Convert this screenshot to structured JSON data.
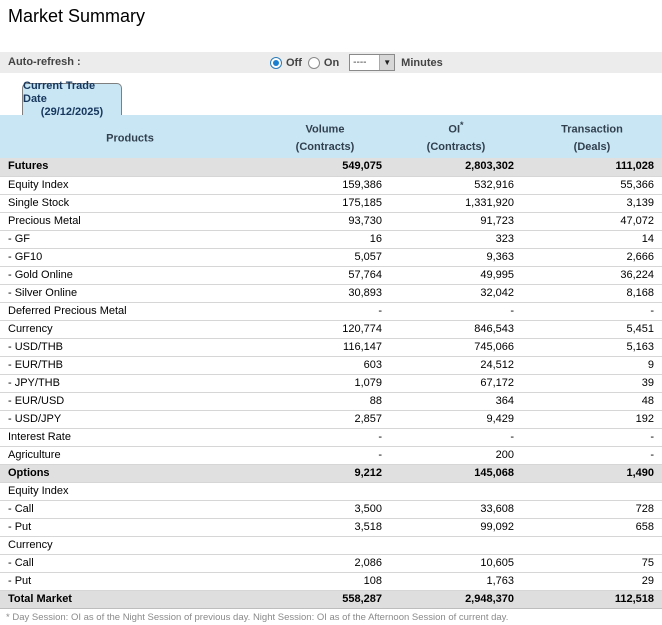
{
  "page": {
    "title": "Market Summary"
  },
  "auto_refresh": {
    "label": "Auto-refresh :",
    "off_label": "Off",
    "on_label": "On",
    "selected": "off",
    "interval_value": "----",
    "minutes_label": "Minutes"
  },
  "tab": {
    "line1": "Current Trade Date",
    "line2": "(29/12/2025)"
  },
  "table": {
    "columns": [
      {
        "label": "Products",
        "sup": "",
        "sub": ""
      },
      {
        "label": "Volume",
        "sup": "",
        "sub": "(Contracts)"
      },
      {
        "label": "OI",
        "sup": "*",
        "sub": "(Contracts)"
      },
      {
        "label": "Transaction",
        "sup": "",
        "sub": "(Deals)"
      }
    ],
    "rows": [
      {
        "product": "Futures",
        "volume": "549,075",
        "oi": "2,803,302",
        "transaction": "111,028",
        "style": "section"
      },
      {
        "product": "Equity Index",
        "volume": "159,386",
        "oi": "532,916",
        "transaction": "55,366",
        "style": "normal"
      },
      {
        "product": "Single Stock",
        "volume": "175,185",
        "oi": "1,331,920",
        "transaction": "3,139",
        "style": "normal"
      },
      {
        "product": "Precious Metal",
        "volume": "93,730",
        "oi": "91,723",
        "transaction": "47,072",
        "style": "normal"
      },
      {
        "product": "- GF",
        "volume": "16",
        "oi": "323",
        "transaction": "14",
        "style": "normal"
      },
      {
        "product": "- GF10",
        "volume": "5,057",
        "oi": "9,363",
        "transaction": "2,666",
        "style": "normal"
      },
      {
        "product": "- Gold Online",
        "volume": "57,764",
        "oi": "49,995",
        "transaction": "36,224",
        "style": "normal"
      },
      {
        "product": "- Silver Online",
        "volume": "30,893",
        "oi": "32,042",
        "transaction": "8,168",
        "style": "normal"
      },
      {
        "product": "Deferred Precious Metal",
        "volume": "-",
        "oi": "-",
        "transaction": "-",
        "style": "normal"
      },
      {
        "product": "Currency",
        "volume": "120,774",
        "oi": "846,543",
        "transaction": "5,451",
        "style": "normal"
      },
      {
        "product": "- USD/THB",
        "volume": "116,147",
        "oi": "745,066",
        "transaction": "5,163",
        "style": "normal"
      },
      {
        "product": "- EUR/THB",
        "volume": "603",
        "oi": "24,512",
        "transaction": "9",
        "style": "normal"
      },
      {
        "product": "- JPY/THB",
        "volume": "1,079",
        "oi": "67,172",
        "transaction": "39",
        "style": "normal"
      },
      {
        "product": "- EUR/USD",
        "volume": "88",
        "oi": "364",
        "transaction": "48",
        "style": "normal"
      },
      {
        "product": "- USD/JPY",
        "volume": "2,857",
        "oi": "9,429",
        "transaction": "192",
        "style": "normal"
      },
      {
        "product": "Interest Rate",
        "volume": "-",
        "oi": "-",
        "transaction": "-",
        "style": "normal"
      },
      {
        "product": "Agriculture",
        "volume": "-",
        "oi": "200",
        "transaction": "-",
        "style": "normal"
      },
      {
        "product": "Options",
        "volume": "9,212",
        "oi": "145,068",
        "transaction": "1,490",
        "style": "section"
      },
      {
        "product": "Equity Index",
        "volume": "",
        "oi": "",
        "transaction": "",
        "style": "normal"
      },
      {
        "product": "- Call",
        "volume": "3,500",
        "oi": "33,608",
        "transaction": "728",
        "style": "normal"
      },
      {
        "product": "- Put",
        "volume": "3,518",
        "oi": "99,092",
        "transaction": "658",
        "style": "normal"
      },
      {
        "product": "Currency",
        "volume": "",
        "oi": "",
        "transaction": "",
        "style": "normal"
      },
      {
        "product": "- Call",
        "volume": "2,086",
        "oi": "10,605",
        "transaction": "75",
        "style": "normal"
      },
      {
        "product": "- Put",
        "volume": "108",
        "oi": "1,763",
        "transaction": "29",
        "style": "normal"
      },
      {
        "product": "Total Market",
        "volume": "558,287",
        "oi": "2,948,370",
        "transaction": "112,518",
        "style": "total"
      }
    ]
  },
  "footnote": "* Day Session: OI as of the Night Session of previous day. Night Session: OI as of the Afternoon Session of current day.",
  "colors": {
    "header_bg": "#c9e6f5",
    "tab_bg": "#c9e6f5",
    "tab_text": "#17375d",
    "section_row_bg": "#e0e0e0",
    "total_row_bg": "#dedede",
    "band_bg": "#ececec",
    "radio_checked": "#1b7fd0"
  }
}
